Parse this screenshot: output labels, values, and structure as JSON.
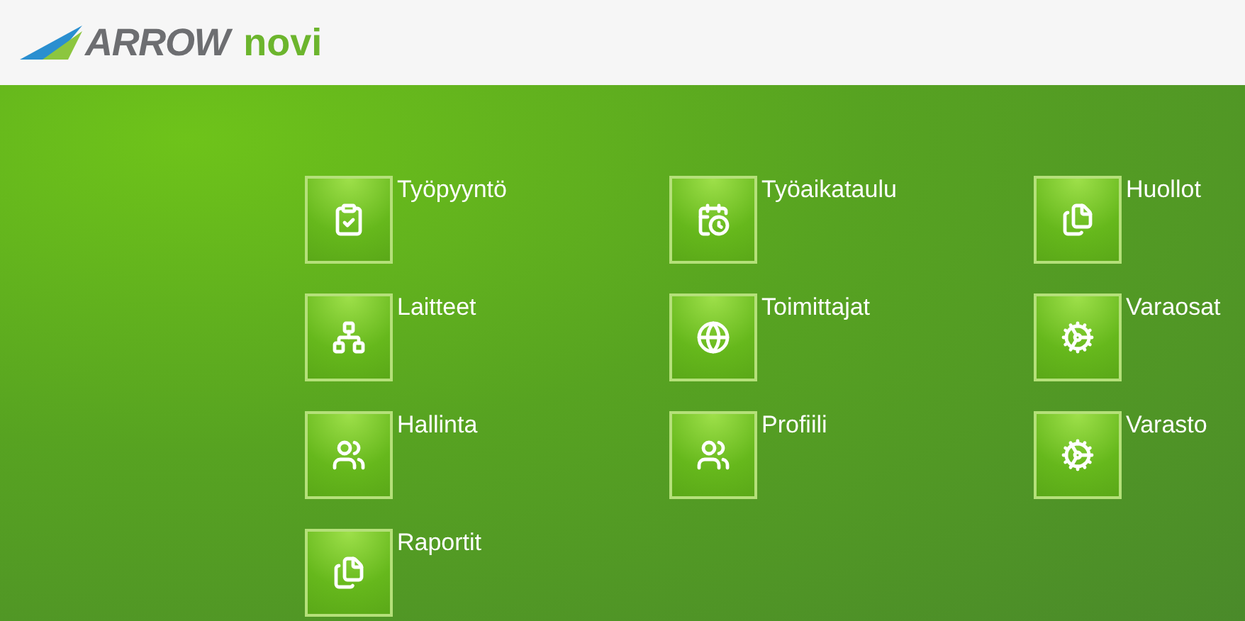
{
  "header": {
    "logo_word": "ARROW",
    "logo_suffix": "novi"
  },
  "tiles": [
    {
      "label": "Työpyyntö"
    },
    {
      "label": "Työaikataulu"
    },
    {
      "label": "Huollot"
    },
    {
      "label": "Laitteet"
    },
    {
      "label": "Toimittajat"
    },
    {
      "label": "Varaosat"
    },
    {
      "label": "Hallinta"
    },
    {
      "label": "Profiili"
    },
    {
      "label": "Varasto"
    },
    {
      "label": "Raportit"
    }
  ]
}
